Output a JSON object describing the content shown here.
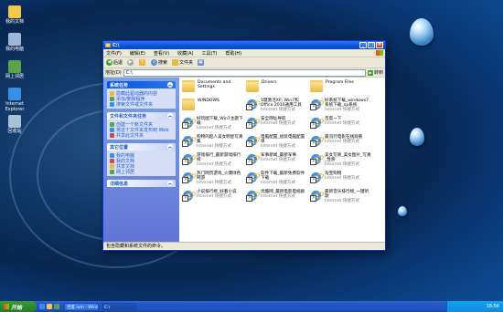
{
  "desktop": {
    "icons": [
      {
        "label": "我的文档",
        "color": "#f0c84a"
      },
      {
        "label": "我的电脑",
        "color": "#9fb6d9"
      },
      {
        "label": "网上邻居",
        "color": "#5aa34a"
      },
      {
        "label": "Internet Explorer",
        "color": "#3a8ee6"
      },
      {
        "label": "回收站",
        "color": "#a9c2d6"
      }
    ]
  },
  "window": {
    "title": "C:\\",
    "menu": [
      "文件(F)",
      "编辑(E)",
      "查看(V)",
      "收藏(A)",
      "工具(T)",
      "帮助(H)"
    ],
    "toolbar": {
      "back": "后退",
      "search": "搜索",
      "folders": "文件夹"
    },
    "address": {
      "label": "地址(D)",
      "value": "C:\\",
      "go": "转到"
    },
    "taskpane": {
      "panels": [
        {
          "title": "系统任务",
          "items": [
            "隐藏此驱动器的内容",
            "添加/删除程序",
            "搜索文件或文件夹"
          ]
        },
        {
          "title": "文件和文件夹任务",
          "items": [
            "创建一个新文件夹",
            "将这个文件夹发布到 Web",
            "共享此文件夹"
          ]
        },
        {
          "title": "其它位置",
          "items": [
            "我的电脑",
            "我的文档",
            "共享文档",
            "网上邻居"
          ]
        },
        {
          "title": "详细信息",
          "items": []
        }
      ]
    },
    "items": [
      {
        "type": "folder",
        "name": "Documents and Settings",
        "sub": ""
      },
      {
        "type": "folder",
        "name": "Drivers",
        "sub": ""
      },
      {
        "type": "folder",
        "name": "Program Files",
        "sub": ""
      },
      {
        "type": "folder",
        "name": "WINDOWS",
        "sub": ""
      },
      {
        "type": "link",
        "name": "1键激活XP, Win7和Office 2010通用工具",
        "sub": "Internet 快捷方式"
      },
      {
        "type": "link",
        "name": "好系统下载_windows7系统下载_xp系统",
        "sub": "Internet 快捷方式"
      },
      {
        "type": "link",
        "name": "好玩图下载_Win7主题下载",
        "sub": "Internet 快捷方式"
      },
      {
        "type": "link",
        "name": "安全网址导航",
        "sub": "Internet 快捷方式"
      },
      {
        "type": "link",
        "name": "百度一下",
        "sub": "Internet 快捷方式"
      },
      {
        "type": "link",
        "name": "购物的超人美女明星写真集",
        "sub": "Internet 快捷方式"
      },
      {
        "type": "link",
        "name": "电脑配置_组装电脑配置单",
        "sub": "Internet 快捷方式"
      },
      {
        "type": "link",
        "name": "最流行电影在线观看",
        "sub": "Internet 快捷方式"
      },
      {
        "type": "link",
        "name": "游戏排行_最新游戏排行榜",
        "sub": "Internet 快捷方式"
      },
      {
        "type": "link",
        "name": "军事新闻_最新军事",
        "sub": "Internet 快捷方式"
      },
      {
        "type": "link",
        "name": "美女写真_美女图片_写真_性感",
        "sub": "Internet 快捷方式"
      },
      {
        "type": "link",
        "name": "热门网页游戏_火爆绿色网游",
        "sub": "Internet 快捷方式"
      },
      {
        "type": "link",
        "name": "软件下载_最新免费软件下载",
        "sub": "Internet 快捷方式"
      },
      {
        "type": "link",
        "name": "淘宝购物",
        "sub": "Internet 快捷方式"
      },
      {
        "type": "link",
        "name": "小说排行榜_好看小说",
        "sub": "Internet 快捷方式"
      },
      {
        "type": "link",
        "name": "优酷网_最新电影电视剧",
        "sub": "Internet 快捷方式"
      },
      {
        "type": "link",
        "name": "最新音乐排行榜_一键听歌",
        "sub": "Internet 快捷方式"
      }
    ],
    "status": "包含隐藏和系统文件的命令。"
  },
  "taskbar": {
    "start": "开始",
    "quicklaunch_colors": [
      "#3a8ee6",
      "#f0c84a",
      "#5aa34a"
    ],
    "buttons": [
      {
        "label": "百度 ium - Windo",
        "active": false
      },
      {
        "label": "C:\\",
        "active": true
      }
    ],
    "clock": "18:56"
  }
}
